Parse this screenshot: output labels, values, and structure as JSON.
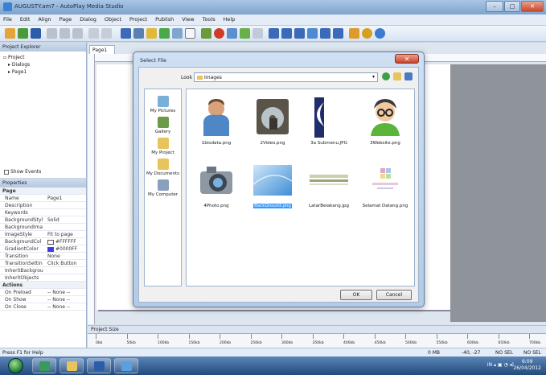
{
  "window": {
    "title": "AUGUSTY.am7 - AutoPlay Media Studio",
    "controls": {
      "minimize": "–",
      "maximize": "□",
      "close": "✕"
    }
  },
  "menu": [
    "File",
    "Edit",
    "Align",
    "Page",
    "Dialog",
    "Object",
    "Project",
    "Publish",
    "View",
    "Tools",
    "Help"
  ],
  "project_explorer": {
    "header": "Project Explorer",
    "tree": [
      "Project",
      "Dialogs",
      "Page1"
    ],
    "show_events": "Show Events"
  },
  "properties": {
    "header": "Properties",
    "rows": [
      {
        "name": "Page",
        "value": "",
        "section": true
      },
      {
        "name": "Name",
        "value": "Page1"
      },
      {
        "name": "Description",
        "value": ""
      },
      {
        "name": "Keywords",
        "value": ""
      },
      {
        "name": "BackgroundStyl",
        "value": "Solid"
      },
      {
        "name": "BackgroundIma",
        "value": ""
      },
      {
        "name": "ImageStyle",
        "value": "Fit to page"
      },
      {
        "name": "BackgroundCol",
        "value": "#FFFFFF",
        "swatch": "#ffffff"
      },
      {
        "name": "GradientColor",
        "value": "#0000FF",
        "swatch": "#3a3ae8"
      },
      {
        "name": "Transition",
        "value": "None"
      },
      {
        "name": "TransitionSettin",
        "value": "Click Button"
      },
      {
        "name": "InheritBackgrou",
        "value": ""
      },
      {
        "name": "InheritObjects",
        "value": ""
      },
      {
        "name": "Actions",
        "value": "",
        "section": true
      },
      {
        "name": "On Preload",
        "value": "-- None --"
      },
      {
        "name": "On Show",
        "value": "-- None --"
      },
      {
        "name": "On Close",
        "value": "-- None --"
      }
    ]
  },
  "workspace": {
    "tab": "Page1",
    "project_size": "Project Size",
    "bottom_ruler_ticks": [
      "0kb",
      "50kb",
      "100kb",
      "150kb",
      "200kb",
      "250kb",
      "300kb",
      "350kb",
      "400kb",
      "450kb",
      "500kb",
      "550kb",
      "600kb",
      "650kb",
      "700kb"
    ]
  },
  "status": {
    "help": "Press F1 for Help",
    "size": "0 MB",
    "coords": "-40, -27",
    "sel1": "NO SEL",
    "sel2": "NO SEL"
  },
  "taskbar": {
    "lang": "IN",
    "time": "6:09",
    "date": "26/04/2012"
  },
  "dialog": {
    "title": "Select File",
    "look_in_label": "Look in",
    "look_in_value": "Images",
    "places": [
      "My Pictures",
      "Gallery",
      "My Project",
      "My Documents",
      "My Computer"
    ],
    "files": [
      {
        "name": "1biodata.png",
        "icon": "person-icon"
      },
      {
        "name": "2Video.png",
        "icon": "cd-dvd-icon"
      },
      {
        "name": "3a Submenu.JPG",
        "icon": "moon-image-icon"
      },
      {
        "name": "3Website.png",
        "icon": "glasses-user-icon"
      },
      {
        "name": "4Photo.png",
        "icon": "camera-icon"
      },
      {
        "name": "BackGround.png",
        "icon": "blue-background-icon",
        "selected": true
      },
      {
        "name": "LatarBelakang.jpg",
        "icon": "stripe-background-icon"
      },
      {
        "name": "Selamat Datang.png",
        "icon": "welcome-logo-icon"
      }
    ],
    "ok": "OK",
    "cancel": "Cancel",
    "close": "✕"
  },
  "colors": {
    "selection": "#3399ff",
    "taskbar": "#2d5a8e"
  }
}
